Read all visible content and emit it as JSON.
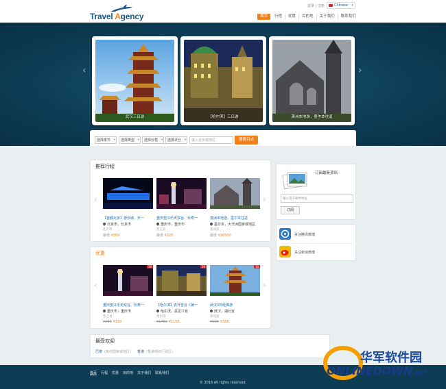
{
  "header": {
    "logo_text_a": "Travel ",
    "logo_text_b": "A",
    "logo_text_c": "gency",
    "top_links": "登录 | 注册",
    "language": "Chinese",
    "nav": [
      "首页",
      "行程",
      "优惠",
      "目的地",
      "关于我们",
      "联系我们"
    ]
  },
  "hero": {
    "slides": [
      {
        "caption": "武汉三日游"
      },
      {
        "caption": "【哈尔滨】三日游"
      },
      {
        "caption": "澳洲本地游，墨尔本往返"
      }
    ]
  },
  "search": {
    "selects": [
      "选择季节",
      "选择类型",
      "选择价格",
      "选择评分"
    ],
    "input_placeholder": "输入省份或地区",
    "button_label": "搜索目点"
  },
  "recommended": {
    "title": "推荐行程",
    "cards": [
      {
        "title": "【首都北京】游长城、天一",
        "loc": "北京市，北京市",
        "sub": "北京市",
        "price_label": "最低",
        "price": "¥389"
      },
      {
        "title": "重庆垫江乐天双谷、长寿一",
        "loc": "重庆市，重庆市",
        "sub": "垫江县",
        "price_label": "最低",
        "price": "¥220"
      },
      {
        "title": "澳洲本地游，墨尔本往返",
        "loc": "墨尔本，大洋洲国家或地区",
        "sub": "澳洲旅",
        "price_label": "最低",
        "price": "¥16500"
      }
    ]
  },
  "deals": {
    "title": "优惠",
    "cards": [
      {
        "title": "重庆垫江乐天双谷、长寿一",
        "loc": "重庆市，重庆市",
        "sub": "垫江县",
        "old": "¥299",
        "price": "¥150"
      },
      {
        "title": "【哈尔滨】去升雪谷（破一",
        "loc": "哈尔滨，黑龙江省",
        "sub": "哈尔滨",
        "old": "¥1450",
        "price": "¥1165"
      },
      {
        "title": "武汉3日经典游",
        "loc": "武汉，湖北省",
        "sub": "湖北省",
        "old": "¥599",
        "price": "¥388"
      }
    ],
    "tag": "10"
  },
  "subscribe": {
    "title": "订阅最新资讯",
    "input_placeholder": "输入电子邮件地址",
    "button_label": "订阅"
  },
  "weibo": {
    "tencent": "关注腾讯微博",
    "sina": "关注新浪微博"
  },
  "popular": {
    "title": "最受欢迎",
    "items": [
      {
        "name": "巴黎",
        "note": "(其他国家或地区)"
      },
      {
        "name": "香港",
        "note": "(香港特别行政区)"
      }
    ]
  },
  "footer": {
    "links": [
      "首页",
      "行程",
      "优惠",
      "目的地",
      "关于我们",
      "联系我们"
    ],
    "copyright": "© 2016 All rights reserved."
  },
  "watermark": {
    "cn": "华军软件园",
    "en": "ONLINEDOWN",
    "suffix": ".NET"
  },
  "colors": {
    "accent": "#f0821e",
    "brand": "#1f5a8a",
    "hero_bg": "#0d3d55",
    "link": "#1f6fb0"
  }
}
